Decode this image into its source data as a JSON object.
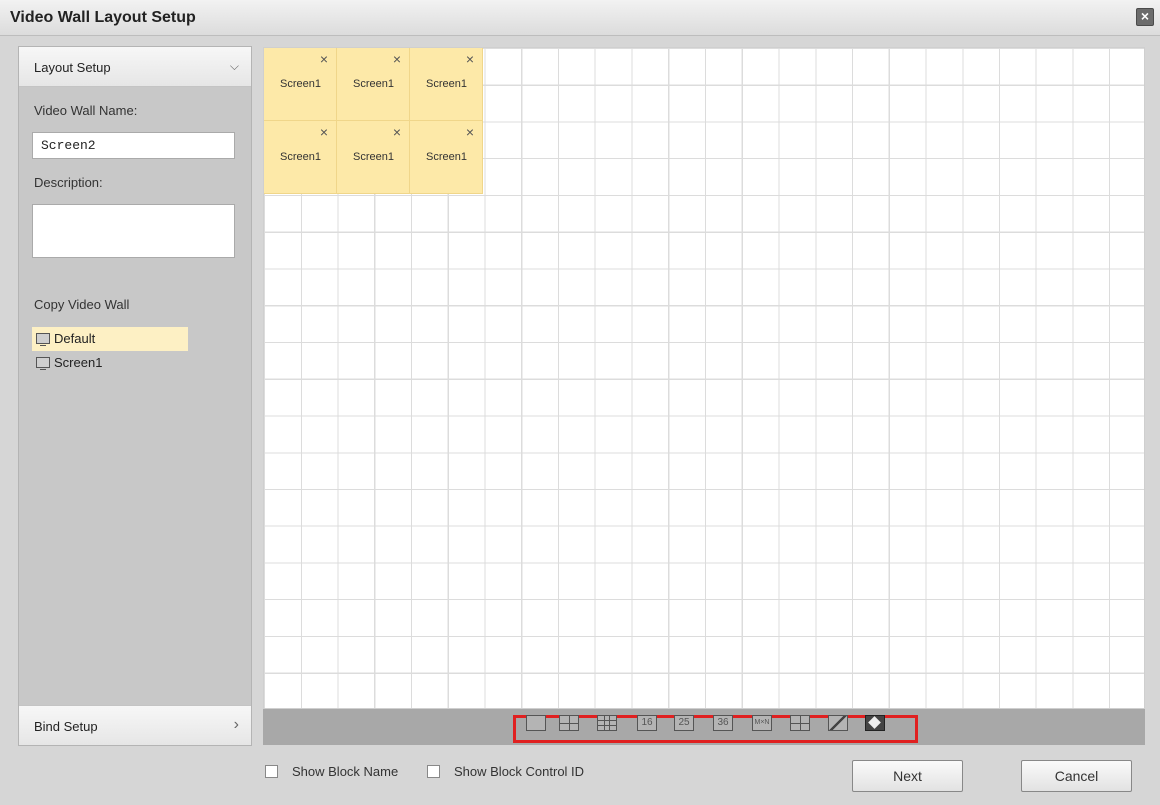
{
  "window": {
    "title": "Video Wall Layout Setup",
    "close_glyph": "×"
  },
  "sidebar": {
    "layout_header": "Layout Setup",
    "layout_chevron": "⌵",
    "name_label": "Video Wall Name:",
    "name_value": "Screen2",
    "description_label": "Description:",
    "description_value": "",
    "copy_label": "Copy Video Wall",
    "copy_items": [
      {
        "label": "Default",
        "selected": true
      },
      {
        "label": "Screen1",
        "selected": false
      }
    ],
    "bind_header": "Bind Setup",
    "bind_chevron": "›"
  },
  "grid": {
    "screens": [
      {
        "name": "Screen1",
        "close": "×"
      },
      {
        "name": "Screen1",
        "close": "×"
      },
      {
        "name": "Screen1",
        "close": "×"
      },
      {
        "name": "Screen1",
        "close": "×"
      },
      {
        "name": "Screen1",
        "close": "×"
      },
      {
        "name": "Screen1",
        "close": "×"
      }
    ]
  },
  "toolbar": {
    "buttons": [
      {
        "icon": "split-1-icon",
        "text": ""
      },
      {
        "icon": "split-4-icon",
        "text": ""
      },
      {
        "icon": "split-9-icon",
        "text": ""
      },
      {
        "icon": "split-16-icon",
        "text": "16"
      },
      {
        "icon": "split-25-icon",
        "text": "25"
      },
      {
        "icon": "split-36-icon",
        "text": "36"
      },
      {
        "icon": "split-mxn-icon",
        "text": "M×N"
      },
      {
        "icon": "merge-icon",
        "text": ""
      },
      {
        "icon": "edit-icon",
        "text": ""
      },
      {
        "icon": "clear-icon",
        "text": ""
      }
    ]
  },
  "footer": {
    "show_block_name": "Show Block Name",
    "show_block_control_id": "Show Block Control ID",
    "next_label": "Next",
    "cancel_label": "Cancel"
  },
  "colors": {
    "screen_fill": "#fde9a8",
    "highlight_border": "#e02020",
    "selected_item": "#fdf0c4"
  }
}
